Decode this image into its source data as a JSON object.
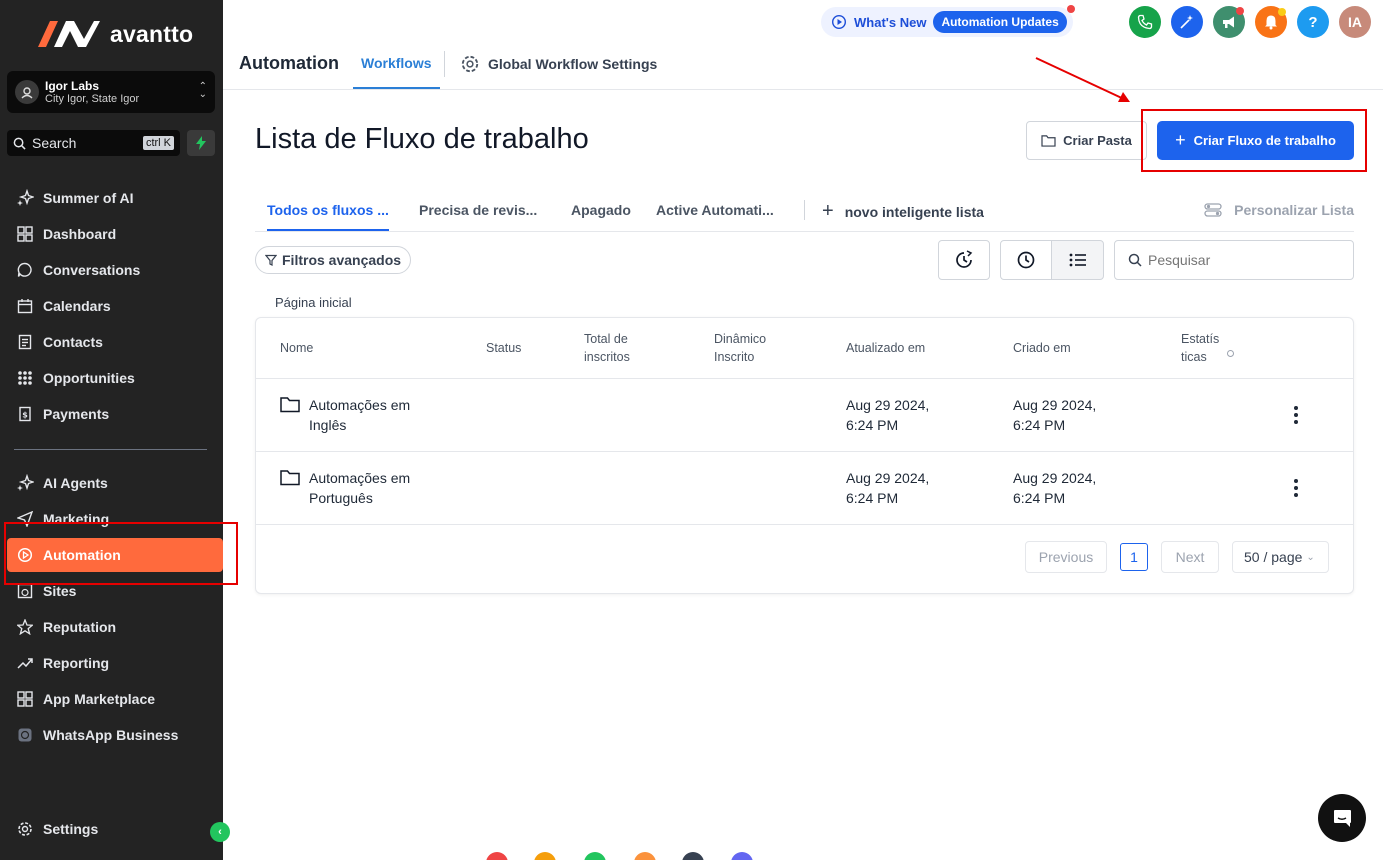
{
  "brand": {
    "name": "avantto",
    "color": "#ff6a3d"
  },
  "account": {
    "name": "Igor Labs",
    "location": "City Igor, State Igor"
  },
  "search": {
    "label": "Search",
    "shortcut": "ctrl K"
  },
  "sidebar": {
    "items": [
      {
        "label": "Summer of AI"
      },
      {
        "label": "Dashboard"
      },
      {
        "label": "Conversations"
      },
      {
        "label": "Calendars"
      },
      {
        "label": "Contacts"
      },
      {
        "label": "Opportunities"
      },
      {
        "label": "Payments"
      },
      {
        "label": "AI Agents"
      },
      {
        "label": "Marketing"
      },
      {
        "label": "Automation"
      },
      {
        "label": "Sites"
      },
      {
        "label": "Reputation"
      },
      {
        "label": "Reporting"
      },
      {
        "label": "App Marketplace"
      },
      {
        "label": "WhatsApp Business"
      },
      {
        "label": "Settings"
      }
    ],
    "active": "Automation"
  },
  "topbar": {
    "whats_new": "What's New",
    "updates": "Automation Updates",
    "avatar": "IA",
    "help": "?"
  },
  "header": {
    "title": "Automation",
    "tab_workflows": "Workflows",
    "tab_global": "Global Workflow Settings"
  },
  "page": {
    "title": "Lista de Fluxo de trabalho",
    "btn_folder": "Criar Pasta",
    "btn_create": "Criar Fluxo de trabalho",
    "tabs": [
      "Todos os fluxos ...",
      "Precisa de revis...",
      "Apagado",
      "Active Automati..."
    ],
    "new_smart_list": "novo inteligente lista",
    "customize": "Personalizar Lista",
    "filters": "Filtros avançados",
    "search_placeholder": "Pesquisar",
    "breadcrumb": "Página inicial"
  },
  "table": {
    "headers": {
      "name": "Nome",
      "status": "Status",
      "total_1": "Total de",
      "total_2": "inscritos",
      "dyn_1": "Dinâmico",
      "dyn_2": "Inscrito",
      "updated": "Atualizado em",
      "created": "Criado em",
      "stats_1": "Estatís",
      "stats_2": "ticas"
    },
    "rows": [
      {
        "name_1": "Automações em",
        "name_2": "Inglês",
        "updated_1": "Aug 29 2024,",
        "updated_2": "6:24 PM",
        "created_1": "Aug 29 2024,",
        "created_2": "6:24 PM"
      },
      {
        "name_1": "Automações em",
        "name_2": "Português",
        "updated_1": "Aug 29 2024,",
        "updated_2": "6:24 PM",
        "created_1": "Aug 29 2024,",
        "created_2": "6:24 PM"
      }
    ]
  },
  "pagination": {
    "previous": "Previous",
    "current": "1",
    "next": "Next",
    "page_size": "50 / page"
  }
}
